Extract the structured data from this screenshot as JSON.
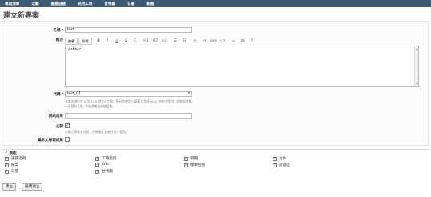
{
  "nav": [
    "專案清單",
    "活動",
    "議題追蹤",
    "耗用工時",
    "甘特圖",
    "日曆",
    "新聞"
  ],
  "page_title": "建立新專案",
  "form": {
    "name_label": "名稱",
    "name_value": "test",
    "desc_label": "概述",
    "editor_tabs": [
      "編輯",
      "預覽"
    ],
    "toolbar": [
      "B",
      "I",
      "U",
      "S",
      "C",
      "H1",
      "H2",
      "H3",
      "☰",
      "☷",
      "⇤",
      "⇥",
      "pre",
      "<>",
      "▭",
      "▤",
      "?"
    ],
    "desc_value": "aabbcc",
    "identifier_label": "代碼",
    "identifier_value": "test_01",
    "clear_icon": "×",
    "identifier_hint1": "長度必須介於 1 至 100 個字元之間，僅允許使用小寫英文字母 (a-z), 阿拉伯數字, 虛線與底線。",
    "identifier_hint2": "一旦儲存之後, 代碼便無法再被變更。",
    "homepage_label": "網站首頁",
    "homepage_value": "",
    "public_label": "公開",
    "public_checked": "✓",
    "public_hint": "公開之專案其內容，在網路上會被任何人看到。",
    "inherit_label": "繼承父專案成員"
  },
  "modules": {
    "title": "✓ 模組",
    "items": [
      {
        "label": "議題追蹤",
        "checked": "✓"
      },
      {
        "label": "工時追蹤",
        "checked": "✓"
      },
      {
        "label": "新聞",
        "checked": "✓"
      },
      {
        "label": "文件",
        "checked": "✓"
      },
      {
        "label": "檔案",
        "checked": "✓"
      },
      {
        "label": "Wiki",
        "checked": "✓"
      },
      {
        "label": "版本控管",
        "checked": "✓"
      },
      {
        "label": "討論區",
        "checked": "✓"
      },
      {
        "label": "日曆",
        "checked": "✓"
      },
      {
        "label": "甘特圖",
        "checked": "✓"
      }
    ]
  },
  "buttons": {
    "create": "建立",
    "create_continue": "繼續建立"
  }
}
